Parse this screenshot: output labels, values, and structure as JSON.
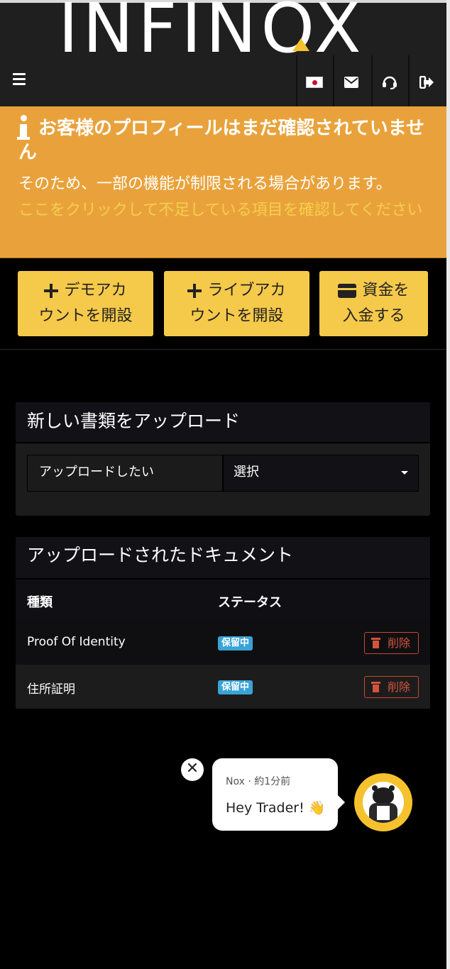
{
  "header": {
    "logo": "INFINOX",
    "language_flag": "japan-flag-icon"
  },
  "warning": {
    "title": "お客様のプロフィールはまだ確認されていません",
    "text": "そのため、一部の機能が制限される場合があります。",
    "link": "ここをクリックして不足している項目を確認してください",
    "color": "#e9a23b"
  },
  "actions": [
    {
      "line1": "デモアカ",
      "line2": "ウントを開設",
      "icon": "plus-icon"
    },
    {
      "line1": "ライブアカ",
      "line2": "ウントを開設",
      "icon": "plus-icon"
    },
    {
      "line1": "資金を",
      "line2": "入金する",
      "icon": "credit-card-icon"
    }
  ],
  "upload": {
    "title": "新しい書類をアップロード",
    "label": "アップロードしたい",
    "selected": "選択"
  },
  "documents": {
    "title": "アップロードされたドキュメント",
    "headers": [
      "種類",
      "ステータス"
    ],
    "rows": [
      {
        "type": "Proof Of Identity",
        "status": "保留中",
        "action": "削除"
      },
      {
        "type": "住所証明",
        "status": "保留中",
        "action": "削除"
      }
    ]
  },
  "chat": {
    "close": "✕",
    "meta": "Nox · 約1分前",
    "message": "Hey Trader! 👋"
  }
}
